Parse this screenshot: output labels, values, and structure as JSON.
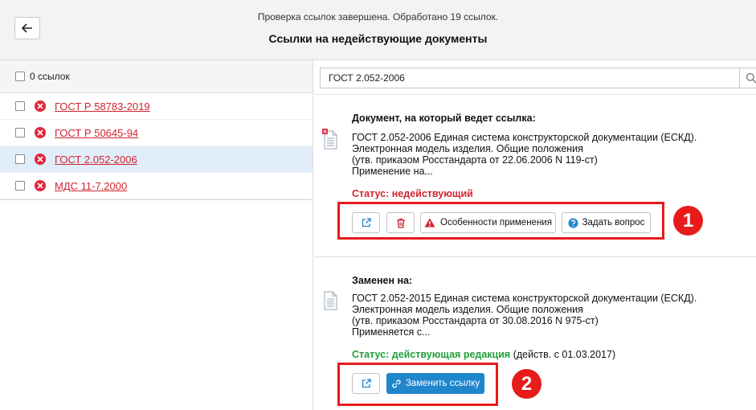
{
  "header": {
    "message": "Проверка ссылок завершена. Обработано 19 ссылок.",
    "title": "Ссылки на недействующие документы"
  },
  "left": {
    "select_all_label": "0 ссылок",
    "items": [
      {
        "label": "ГОСТ Р 58783-2019",
        "selected": false
      },
      {
        "label": "ГОСТ Р 50645-94",
        "selected": false
      },
      {
        "label": "ГОСТ 2.052-2006",
        "selected": true
      },
      {
        "label": "МДС 11-7.2000",
        "selected": false
      }
    ]
  },
  "search": {
    "value": "ГОСТ 2.052-2006"
  },
  "current_doc": {
    "heading": "Документ, на который ведет ссылка:",
    "lines": [
      "ГОСТ 2.052-2006 Единая система конструкторской документации (ЕСКД).",
      "Электронная модель изделия. Общие положения",
      "(утв. приказом Росстандарта от 22.06.2006 N 119-ст)",
      "Применение на..."
    ],
    "status": "Статус: недействующий",
    "buttons": {
      "features": "Особенности применения",
      "ask": "Задать вопрос"
    },
    "badge": "1"
  },
  "replacement": {
    "heading": "Заменен на:",
    "lines": [
      "ГОСТ 2.052-2015 Единая система конструкторской документации (ЕСКД).",
      "Электронная модель изделия. Общие положения",
      "(утв. приказом Росстандарта от 30.08.2016 N 975-ст)",
      "Применяется с..."
    ],
    "status": "Статус: действующая редакция",
    "status_note": "(действ. с 01.03.2017)",
    "buttons": {
      "replace": "Заменить ссылку"
    },
    "badge": "2"
  },
  "colors": {
    "error": "#d0242f",
    "ok": "#1e9e3a",
    "primary": "#1f86cc",
    "highlight": "#e81a1a"
  }
}
